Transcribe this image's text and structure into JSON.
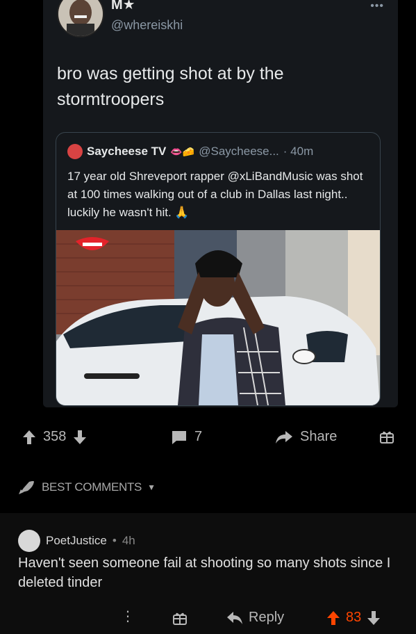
{
  "tweet": {
    "author_name": "M★",
    "author_handle": "@whereiskhi",
    "more_icon": "more-horizontal-icon",
    "text": "bro was getting shot at by the stormtroopers",
    "quote": {
      "author_name": "Saycheese TV",
      "emojis": "👄🧀",
      "handle": "@Saycheese...",
      "time": "· 40m",
      "text": "17 year old Shreveport rapper @xLiBandMusic was shot at 100 times walking out of a club in Dallas last night.. luckily he wasn't hit. 🙏"
    }
  },
  "post_actions": {
    "upvote_count": "358",
    "comment_count": "7",
    "share_label": "Share"
  },
  "comments_header": {
    "label": "BEST COMMENTS",
    "icon": "rocket-icon"
  },
  "comment": {
    "author": "PoetJustice",
    "separator": "•",
    "time": "4h",
    "text": "Haven't seen someone fail at shooting so many shots since I deleted tinder",
    "reply_label": "Reply",
    "score": "83",
    "score_color": "#ff4500"
  },
  "colors": {
    "card_bg": "#15181c",
    "muted": "#8b98a5",
    "upvote": "#ff4500"
  }
}
